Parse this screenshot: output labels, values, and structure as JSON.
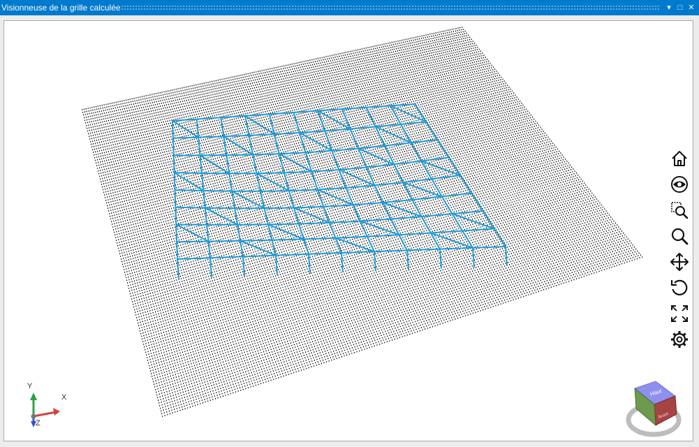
{
  "window": {
    "title": "Visionneuse de la grille calculée",
    "controls": {
      "pin": "▾",
      "maximize": "□",
      "close": "✕"
    }
  },
  "colors": {
    "titlebar": "#007acc",
    "dot_grid": "#000000",
    "surface_mesh": "#1e9bd7",
    "axis_x": "#d0453c",
    "axis_y": "#2ea043",
    "axis_z": "#3050d0",
    "cube_top": "#8f8ff0",
    "cube_front": "#a84343",
    "cube_side": "#6d9a4e"
  },
  "toolbar": {
    "tools": [
      {
        "name": "home-icon"
      },
      {
        "name": "eye-icon"
      },
      {
        "name": "zoom-window-icon"
      },
      {
        "name": "zoom-icon"
      },
      {
        "name": "pan-icon"
      },
      {
        "name": "rotate-icon"
      },
      {
        "name": "fit-extents-icon"
      },
      {
        "name": "settings-gear-icon"
      }
    ]
  },
  "axes": {
    "x": "X",
    "y": "Y",
    "z": "Z"
  },
  "viewcube": {
    "top": "Haut",
    "front": "Avant"
  }
}
